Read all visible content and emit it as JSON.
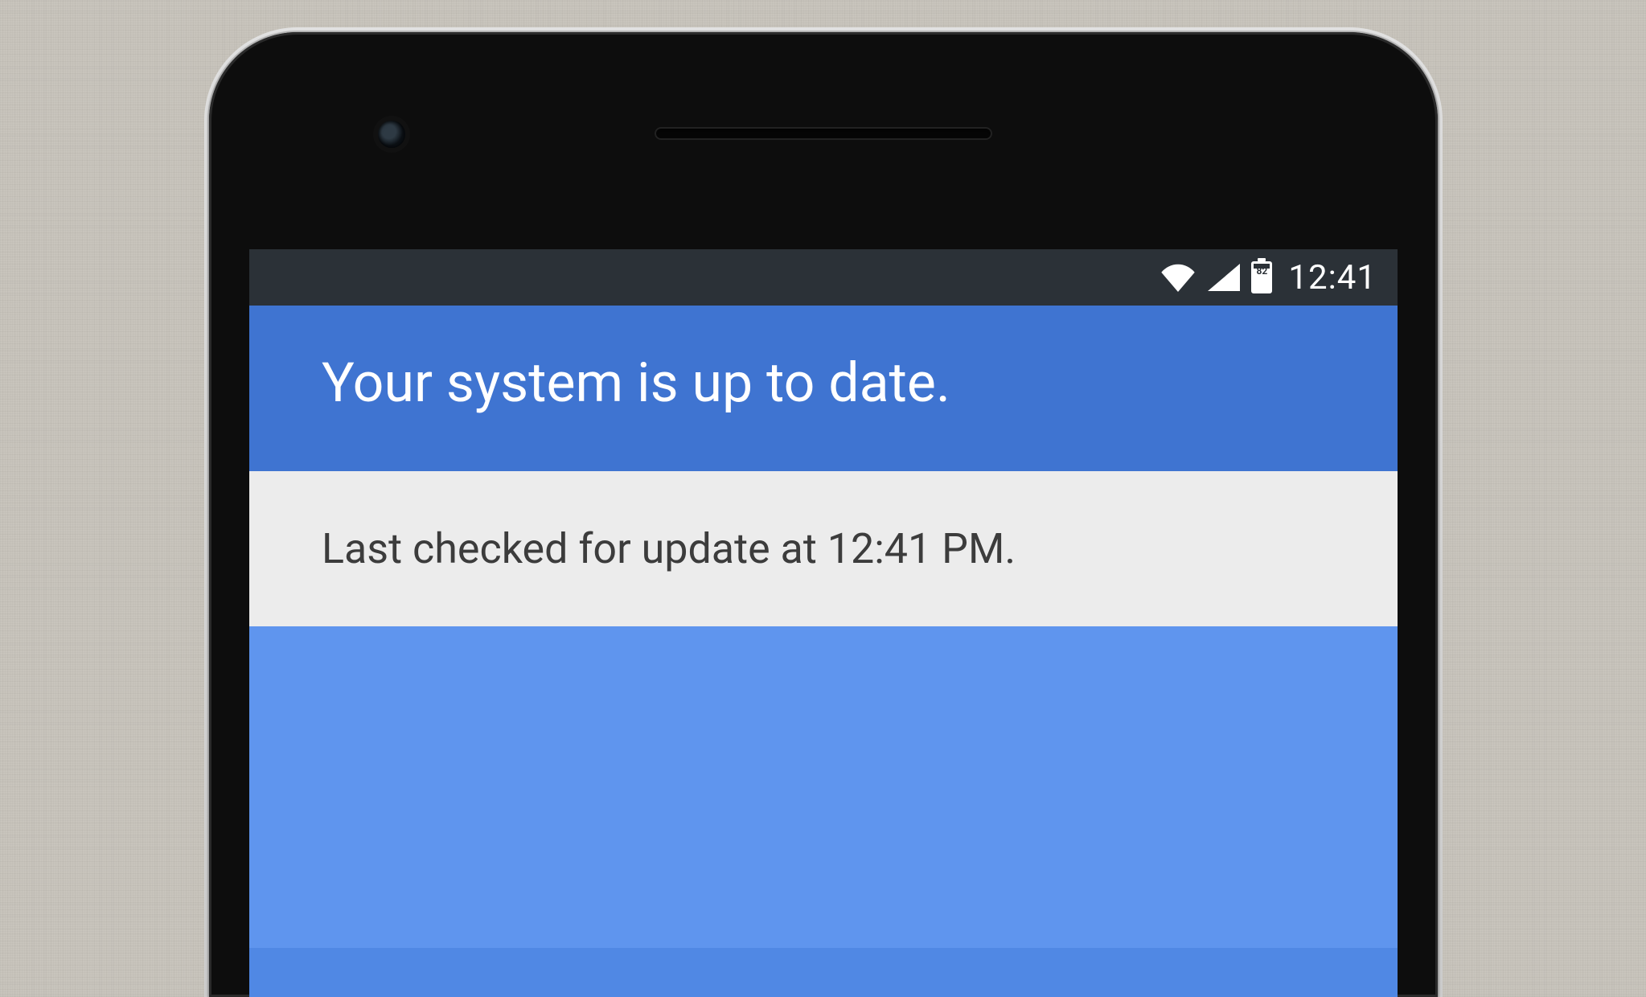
{
  "statusbar": {
    "battery_percent": "82",
    "clock": "12:41"
  },
  "header": {
    "title": "Your system is up to date."
  },
  "info": {
    "last_checked": "Last checked for update at 12:41 PM."
  }
}
